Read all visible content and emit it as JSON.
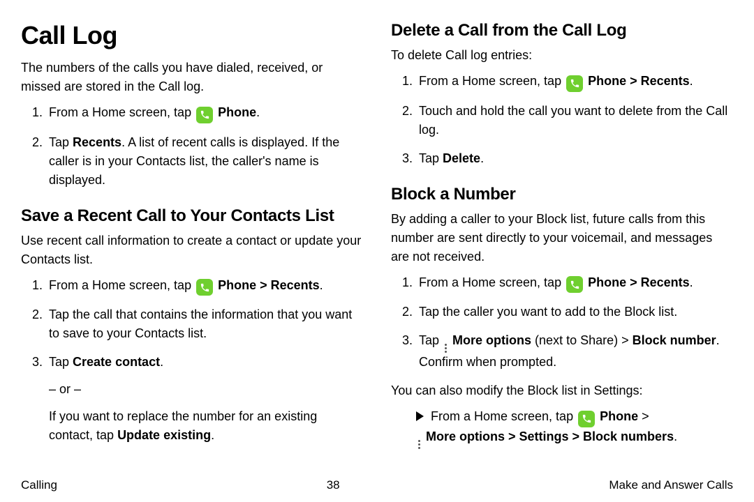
{
  "left": {
    "h1": "Call Log",
    "intro": "The numbers of the calls you have dialed, received, or missed are stored in the Call log.",
    "li1_pre": "From a Home screen, tap ",
    "li1_bold": "Phone",
    "li1_post": ".",
    "li2_pre": "Tap ",
    "li2_bold": "Recents",
    "li2_post": ". A list of recent calls is displayed. If the caller is in your Contacts list, the caller's name is displayed.",
    "h2a": "Save a Recent Call to Your Contacts List",
    "save_intro": "Use recent call information to create a contact or update your Contacts list.",
    "s1_pre": "From a Home screen, tap ",
    "s1_bold": "Phone > Recents",
    "s1_post": ".",
    "s2": "Tap the call that contains the information that you want to save to your Contacts list.",
    "s3_pre": "Tap ",
    "s3_bold": "Create contact",
    "s3_post": ".",
    "s3_or": "– or –",
    "s3_alt_pre": "If you want to replace the number for an existing contact, tap ",
    "s3_alt_bold": "Update existing",
    "s3_alt_post": "."
  },
  "right": {
    "h2a": "Delete a Call from the Call Log",
    "del_intro": "To delete Call log entries:",
    "d1_pre": "From a Home screen, tap ",
    "d1_bold": "Phone > Recents",
    "d1_post": ".",
    "d2": "Touch and hold the call you want to delete from the Call log.",
    "d3_pre": "Tap ",
    "d3_bold": "Delete",
    "d3_post": ".",
    "h2b": "Block a Number",
    "blk_intro": "By adding a caller to your Block list, future calls from this number are sent directly to your voicemail, and messages are not received.",
    "b1_pre": "From a Home screen, tap ",
    "b1_bold": "Phone > Recents",
    "b1_post": ".",
    "b2": "Tap the caller you want to add to the Block list.",
    "b3_pre": "Tap ",
    "b3_bold1": "More options",
    "b3_mid": " (next to Share) > ",
    "b3_bold2": "Block number",
    "b3_post": ". Confirm when prompted.",
    "blk_also": "You can also modify the Block list in Settings:",
    "bl_pre": "From a Home screen, tap ",
    "bl_bold1": "Phone",
    "bl_mid": " > ",
    "bl_bold2": "More options > Settings > Block numbers",
    "bl_post": "."
  },
  "footer": {
    "left": "Calling",
    "center": "38",
    "right": "Make and Answer Calls"
  }
}
